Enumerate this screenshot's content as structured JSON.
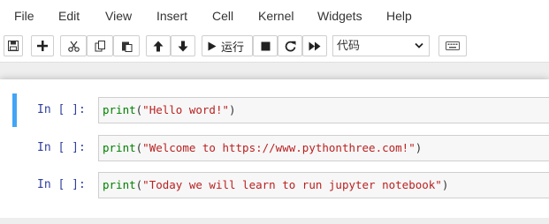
{
  "menu": {
    "items": [
      "File",
      "Edit",
      "View",
      "Insert",
      "Cell",
      "Kernel",
      "Widgets",
      "Help"
    ]
  },
  "toolbar": {
    "buttons": [
      {
        "name": "save-icon"
      },
      {
        "name": "plus-icon"
      },
      {
        "name": "cut-icon"
      },
      {
        "name": "copy-icon"
      },
      {
        "name": "paste-icon"
      },
      {
        "name": "arrow-up-icon"
      },
      {
        "name": "arrow-down-icon"
      },
      {
        "name": "play-icon",
        "label": "运行"
      },
      {
        "name": "stop-icon"
      },
      {
        "name": "restart-icon"
      },
      {
        "name": "fast-forward-icon"
      }
    ],
    "cell_type": "代码",
    "keyboard": "keyboard-icon"
  },
  "cells": [
    {
      "prompt": "In [ ]:",
      "func": "print",
      "open": "(",
      "string": "\"Hello word!\"",
      "close": ")"
    },
    {
      "prompt": "In [ ]:",
      "func": "print",
      "open": "(",
      "string": "\"Welcome to https://www.pythonthree.com!\"",
      "close": ")"
    },
    {
      "prompt": "In [ ]:",
      "func": "print",
      "open": "(",
      "string": "\"Today we will learn to run jupyter notebook\"",
      "close": ")"
    }
  ],
  "colors": {
    "selected_cell_border": "#42a5f5",
    "prompt": "#303f9f",
    "keyword": "#008000",
    "string": "#ba2121"
  }
}
